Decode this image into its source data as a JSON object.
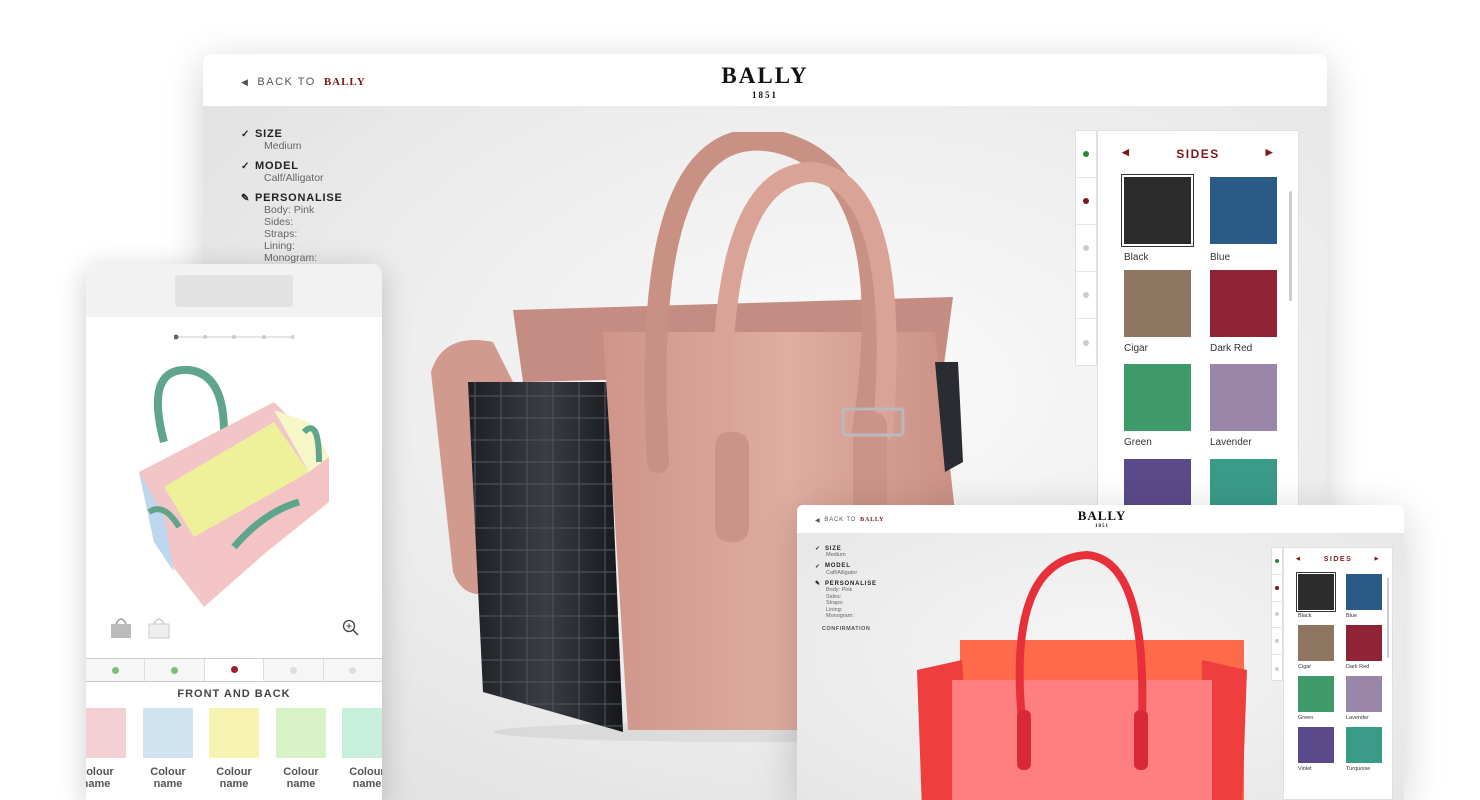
{
  "brand": {
    "name": "BALLY",
    "year": "1851"
  },
  "nav": {
    "back_prefix": "BACK TO",
    "back_target": "BALLY"
  },
  "steps": [
    {
      "icon": "check",
      "title": "SIZE",
      "values": [
        "Medium"
      ]
    },
    {
      "icon": "check",
      "title": "MODEL",
      "values": [
        "Calf/Alligator"
      ]
    },
    {
      "icon": "pencil",
      "title": "PERSONALISE",
      "values": [
        "Body: Pink",
        "Sides:",
        "Straps:",
        "Lining:",
        "Monogram:"
      ]
    }
  ],
  "confirmation": "CONFIRMATION",
  "panel": {
    "title": "SIDES",
    "tab_dot_colors": [
      "#2a8a2a",
      "#7a1a1a",
      "#cccccc",
      "#cccccc",
      "#cccccc"
    ],
    "swatches": [
      {
        "label": "Black",
        "color": "#2c2c2c",
        "selected": true
      },
      {
        "label": "Blue",
        "color": "#2a5a86"
      },
      {
        "label": "Cigar",
        "color": "#8d7560"
      },
      {
        "label": "Dark Red",
        "color": "#8e2436"
      },
      {
        "label": "Green",
        "color": "#3f9a6a"
      },
      {
        "label": "Lavender",
        "color": "#9a86a8"
      },
      {
        "label": "Violet",
        "color": "#5b4a8a"
      },
      {
        "label": "Turquoise",
        "color": "#3a9b88"
      }
    ]
  },
  "phone": {
    "section_title": "FRONT AND BACK",
    "tab_dot_colors": [
      "#7ac07a",
      "#7ac07a",
      "#9a2030",
      "#dddddd",
      "#dddddd"
    ],
    "chips": [
      {
        "label": "Colour name",
        "color": "#f2d0d4"
      },
      {
        "label": "Colour name",
        "color": "#cfe4f0"
      },
      {
        "label": "Colour name",
        "color": "#f6f2b0"
      },
      {
        "label": "Colour name",
        "color": "#d8f2c8"
      },
      {
        "label": "Colour name",
        "color": "#c8eedc"
      }
    ]
  }
}
